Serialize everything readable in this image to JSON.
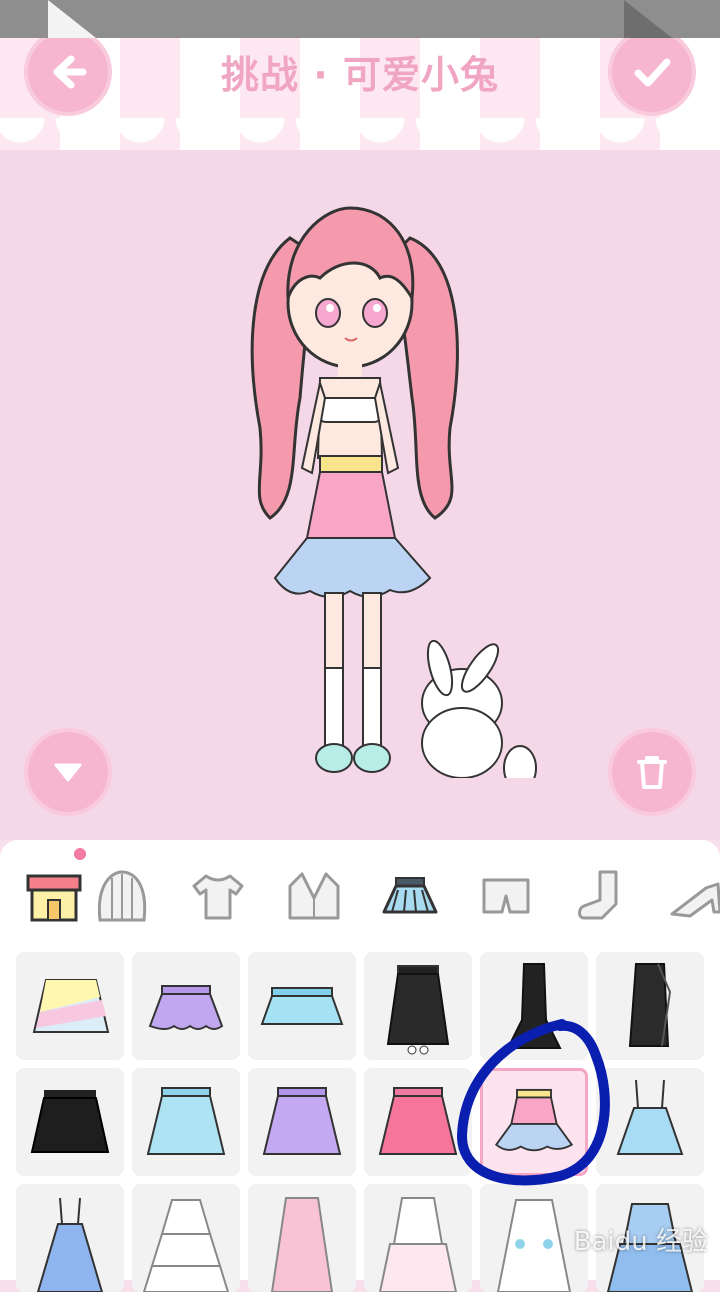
{
  "header": {
    "title": "挑战 · 可爱小兔"
  },
  "watermark": "Baidu 经验",
  "icons": {
    "back": "arrow-left-icon",
    "confirm": "checkmark-icon",
    "collapse": "chevron-down-icon",
    "delete": "trash-icon"
  },
  "categories": [
    {
      "name": "shop",
      "icon": "shop-icon",
      "badge": true
    },
    {
      "name": "hair",
      "icon": "hair-icon"
    },
    {
      "name": "top",
      "icon": "tshirt-icon"
    },
    {
      "name": "jacket",
      "icon": "jacket-icon"
    },
    {
      "name": "skirt",
      "icon": "skirt-icon",
      "selected": true
    },
    {
      "name": "shorts",
      "icon": "shorts-icon"
    },
    {
      "name": "socks",
      "icon": "sock-icon"
    },
    {
      "name": "shoes",
      "icon": "heel-shoe-icon"
    }
  ],
  "items": [
    {
      "type": "rainbow-mini-skirt"
    },
    {
      "type": "purple-scalloped-skirt"
    },
    {
      "type": "blue-pleated-skirt"
    },
    {
      "type": "black-long-skirt"
    },
    {
      "type": "black-mermaid-skirt"
    },
    {
      "type": "black-wrap-skirt"
    },
    {
      "type": "black-pleated-skirt"
    },
    {
      "type": "lightblue-pleated-skirt"
    },
    {
      "type": "lavender-pleated-skirt"
    },
    {
      "type": "pink-pleated-skirt"
    },
    {
      "type": "pink-bunny-skirt",
      "selected": true,
      "circled": true
    },
    {
      "type": "blue-suspender-skirt"
    },
    {
      "type": "blue-overall-dress"
    },
    {
      "type": "white-tiered-skirt"
    },
    {
      "type": "pink-long-skirt"
    },
    {
      "type": "white-ruffle-skirt"
    },
    {
      "type": "white-bow-skirt"
    },
    {
      "type": "blue-ruffle-skirt"
    }
  ],
  "colors": {
    "accent": "#f7b6cf",
    "background": "#f5d8e8",
    "annotation": "#0a1fb0"
  }
}
